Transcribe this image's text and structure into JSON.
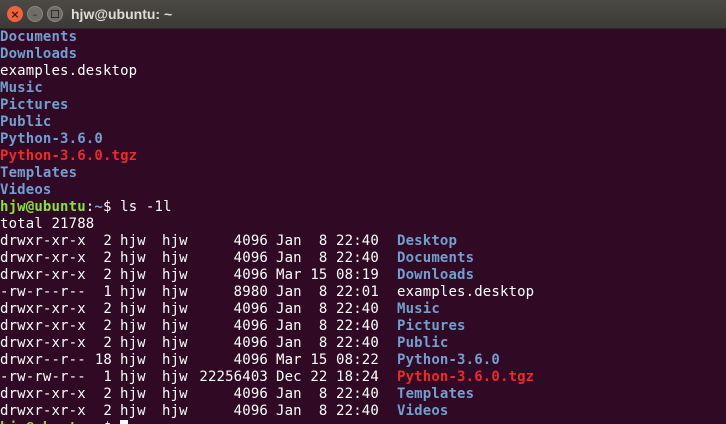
{
  "window": {
    "title": "hjw@ubuntu: ~"
  },
  "terminal": {
    "listing": [
      {
        "name": "Documents",
        "kind": "dir"
      },
      {
        "name": "Downloads",
        "kind": "dir"
      },
      {
        "name": "examples.desktop",
        "kind": "file"
      },
      {
        "name": "Music",
        "kind": "dir"
      },
      {
        "name": "Pictures",
        "kind": "dir"
      },
      {
        "name": "Public",
        "kind": "dir"
      },
      {
        "name": "Python-3.6.0",
        "kind": "dir"
      },
      {
        "name": "Python-3.6.0.tgz",
        "kind": "archive"
      },
      {
        "name": "Templates",
        "kind": "dir"
      },
      {
        "name": "Videos",
        "kind": "dir"
      }
    ],
    "prompt": {
      "user": "hjw@ubuntu",
      "path": "~",
      "symbol": "$",
      "command": "ls -1l"
    },
    "total": "total 21788",
    "long_listing": [
      {
        "perms": "drwxr-xr-x",
        "links": "2",
        "owner": "hjw",
        "group": "hjw",
        "size": "4096",
        "date": "Jan  8 22:40",
        "name": "Desktop",
        "kind": "dir"
      },
      {
        "perms": "drwxr-xr-x",
        "links": "2",
        "owner": "hjw",
        "group": "hjw",
        "size": "4096",
        "date": "Jan  8 22:40",
        "name": "Documents",
        "kind": "dir"
      },
      {
        "perms": "drwxr-xr-x",
        "links": "2",
        "owner": "hjw",
        "group": "hjw",
        "size": "4096",
        "date": "Mar 15 08:19",
        "name": "Downloads",
        "kind": "dir"
      },
      {
        "perms": "-rw-r--r--",
        "links": "1",
        "owner": "hjw",
        "group": "hjw",
        "size": "8980",
        "date": "Jan  8 22:01",
        "name": "examples.desktop",
        "kind": "file"
      },
      {
        "perms": "drwxr-xr-x",
        "links": "2",
        "owner": "hjw",
        "group": "hjw",
        "size": "4096",
        "date": "Jan  8 22:40",
        "name": "Music",
        "kind": "dir"
      },
      {
        "perms": "drwxr-xr-x",
        "links": "2",
        "owner": "hjw",
        "group": "hjw",
        "size": "4096",
        "date": "Jan  8 22:40",
        "name": "Pictures",
        "kind": "dir"
      },
      {
        "perms": "drwxr-xr-x",
        "links": "2",
        "owner": "hjw",
        "group": "hjw",
        "size": "4096",
        "date": "Jan  8 22:40",
        "name": "Public",
        "kind": "dir"
      },
      {
        "perms": "drwxr--r--",
        "links": "18",
        "owner": "hjw",
        "group": "hjw",
        "size": "4096",
        "date": "Mar 15 08:22",
        "name": "Python-3.6.0",
        "kind": "dir"
      },
      {
        "perms": "-rw-rw-r--",
        "links": "1",
        "owner": "hjw",
        "group": "hjw",
        "size": "22256403",
        "date": "Dec 22 18:24",
        "name": "Python-3.6.0.tgz",
        "kind": "archive"
      },
      {
        "perms": "drwxr-xr-x",
        "links": "2",
        "owner": "hjw",
        "group": "hjw",
        "size": "4096",
        "date": "Jan  8 22:40",
        "name": "Templates",
        "kind": "dir"
      },
      {
        "perms": "drwxr-xr-x",
        "links": "2",
        "owner": "hjw",
        "group": "hjw",
        "size": "4096",
        "date": "Jan  8 22:40",
        "name": "Videos",
        "kind": "dir"
      }
    ]
  },
  "colors": {
    "background": "#300a24",
    "directory": "#729fcf",
    "archive": "#ef2929",
    "prompt_user": "#8ae234",
    "text": "#ffffff",
    "close_button": "#f0623c"
  },
  "icons": {
    "close": "close-icon",
    "minimize": "minimize-icon",
    "maximize": "maximize-icon"
  }
}
